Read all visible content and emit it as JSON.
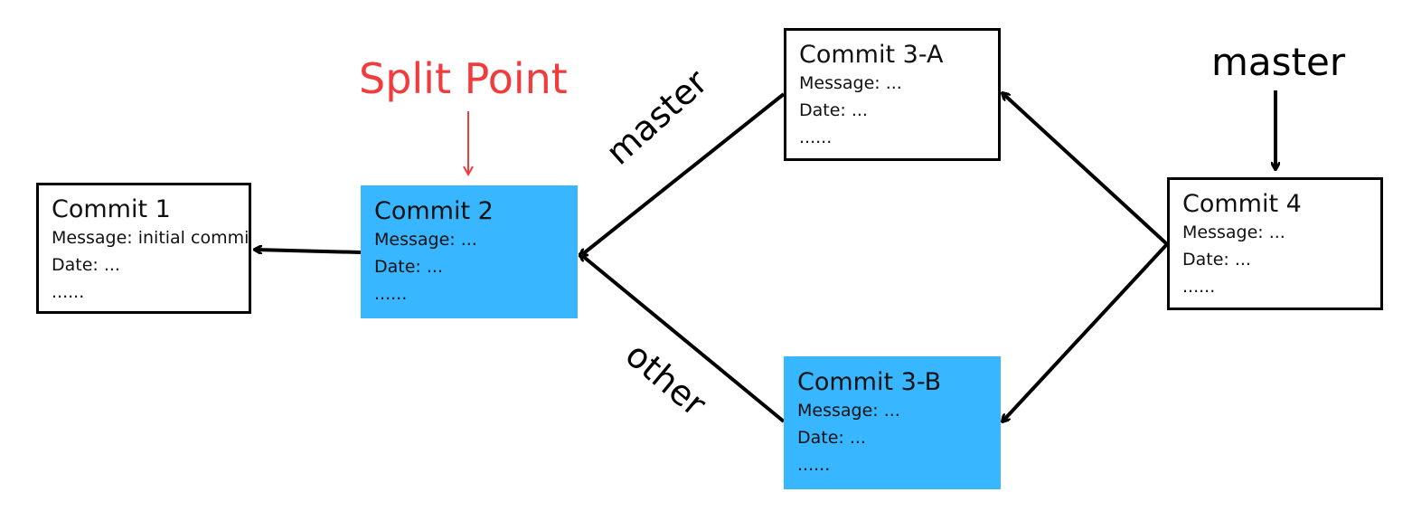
{
  "commits": {
    "c1": {
      "title": "Commit 1",
      "message": "Message: initial commit",
      "date": "Date: ...",
      "more": "......"
    },
    "c2": {
      "title": "Commit 2",
      "message": "Message: ...",
      "date": "Date: ...",
      "more": "......"
    },
    "c3a": {
      "title": "Commit 3-A",
      "message": "Message: ...",
      "date": "Date: ...",
      "more": "......"
    },
    "c3b": {
      "title": "Commit 3-B",
      "message": "Message: ...",
      "date": "Date: ...",
      "more": "......"
    },
    "c4": {
      "title": "Commit 4",
      "message": "Message: ...",
      "date": "Date: ...",
      "more": "......"
    }
  },
  "labels": {
    "split_point": "Split Point",
    "master_top": "master",
    "master_edge": "master",
    "other_edge": "other"
  },
  "colors": {
    "highlight": "#38b6ff",
    "split_point": "#f03c3c",
    "arrow": "#000000"
  }
}
